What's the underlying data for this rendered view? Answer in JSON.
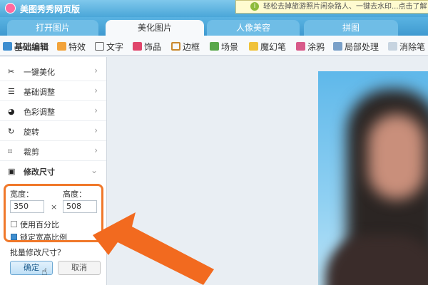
{
  "app": {
    "title": "美图秀秀网页版"
  },
  "notice": {
    "text": "轻松去掉旅游照片闲杂路人、一键去水印...点击了解"
  },
  "tabs": [
    {
      "label": "打开图片"
    },
    {
      "label": "美化图片"
    },
    {
      "label": "人像美容"
    },
    {
      "label": "拼图"
    }
  ],
  "toolbar": {
    "items": [
      {
        "label": "基础编辑"
      },
      {
        "label": "特效"
      },
      {
        "label": "文字"
      },
      {
        "label": "饰品"
      },
      {
        "label": "边框"
      },
      {
        "label": "场景"
      },
      {
        "label": "魔幻笔"
      },
      {
        "label": "涂鸦"
      },
      {
        "label": "局部处理"
      },
      {
        "label": "消除笔"
      }
    ]
  },
  "sidebar": {
    "items": [
      {
        "label": "一键美化"
      },
      {
        "label": "基础调整"
      },
      {
        "label": "色彩调整"
      },
      {
        "label": "旋转"
      },
      {
        "label": "裁剪"
      },
      {
        "label": "修改尺寸"
      }
    ]
  },
  "resize": {
    "width_label": "宽度：",
    "height_label": "高度：",
    "width_value": "350",
    "height_value": "508",
    "times": "×",
    "percent_label": "使用百分比",
    "lock_label": "锁定宽高比例",
    "batch_link": "批量修改尺寸？",
    "ok_label": "确定",
    "cancel_label": "取消"
  },
  "colors": {
    "accent": "#4aa6d8",
    "highlight": "#f0782a",
    "arrow": "#f26a1f"
  }
}
